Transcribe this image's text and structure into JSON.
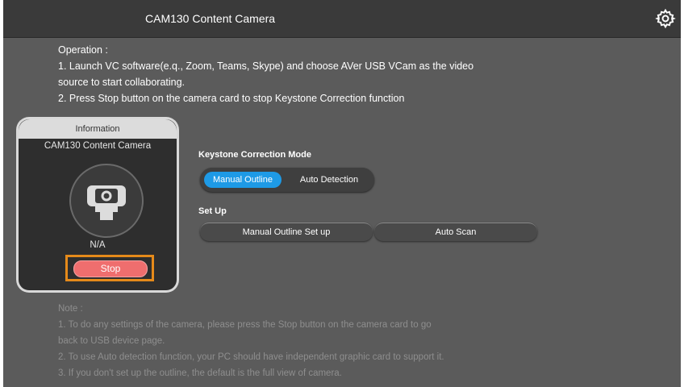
{
  "header": {
    "title": "CAM130 Content Camera",
    "settings_icon": "gear-icon"
  },
  "operation": {
    "heading": "Operation :",
    "line1": "1. Launch VC software(e.q., Zoom, Teams, Skype) and choose AVer USB VCam as the video",
    "line2": "source to start collaborating.",
    "line3": "2. Press Stop button on the camera card to stop Keystone Correction function"
  },
  "card": {
    "header": "Information",
    "name": "CAM130 Content Camera",
    "icon": "camera-icon",
    "status": "N/A",
    "stop_label": "Stop",
    "highlight_color": "#e58a1a",
    "stop_color": "#ef6e6e"
  },
  "keystone": {
    "label": "Keystone Correction Mode",
    "options": [
      "Manual Outline",
      "Auto Detection"
    ],
    "selected": "Manual Outline",
    "accent": "#1e9ae6"
  },
  "setup": {
    "label": "Set Up",
    "manual_button": "Manual Outline Set up",
    "auto_button": "Auto Scan"
  },
  "note": {
    "heading": "Note :",
    "line1": "1. To do any settings of the camera, please press the Stop button on the camera card to go",
    "line2": "back to USB device page.",
    "line3": "2. To use Auto detection function, your PC should have independent graphic card to support it.",
    "line4": "3. If you don't set up the outline, the default is the full view of camera."
  }
}
